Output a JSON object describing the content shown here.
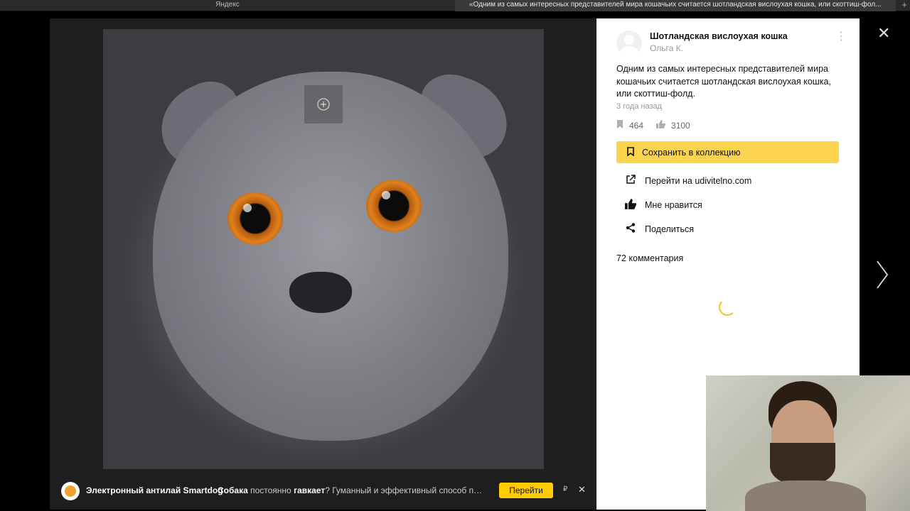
{
  "browser": {
    "tabs": [
      {
        "label": "Яндекс"
      },
      {
        "label": "«Одним из самых интересных представителей мира кошачьих считается шотландская вислоухая кошка, или скоттиш-фол..."
      }
    ],
    "new_tab_glyph": "+"
  },
  "viewer": {
    "image_alt": "cat-photo",
    "zoom_glyph": "⊕"
  },
  "ad": {
    "title": "Электронный антилай Smartdog",
    "text_parts": [
      "Собака",
      " постоянно ",
      "гавкает",
      "? Гуманный и эффективный способ приоб..."
    ],
    "button": "Перейти",
    "mark": "₽",
    "close": "✕"
  },
  "panel": {
    "title": "Шотландская вислоухая кошка",
    "author": "Ольга К.",
    "description": "Одним из самых интересных представителей мира кошачьих считается шотландская вислоухая кошка, или скоттиш-фолд.",
    "time_ago": "3 года назад",
    "saves_count": "464",
    "likes_count": "3100",
    "save_button": "Сохранить в коллекцию",
    "actions": {
      "goto": "Перейти на udivitelno.com",
      "like": "Мне нравится",
      "share": "Поделиться"
    },
    "comments": "72 комментария"
  },
  "controls": {
    "close": "✕"
  },
  "colors": {
    "accent": "#fcd34d",
    "ad_button": "#ffcc00",
    "panel_bg": "#ffffff",
    "viewer_bg": "#1e1e1e"
  }
}
